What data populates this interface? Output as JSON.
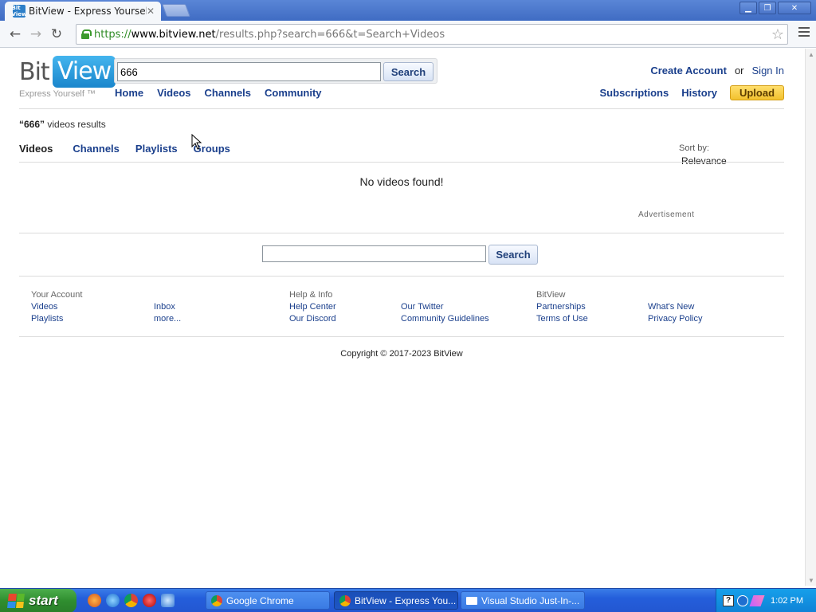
{
  "browser": {
    "tab_title": "BitView - Express Yourself.",
    "favicon_text": "Bit View",
    "url_scheme": "https://",
    "url_host": "www.bitview.net",
    "url_path": "/results.php?search=666&t=Search+Videos"
  },
  "site": {
    "logo_bit": "Bit",
    "logo_view": "View",
    "tagline": "Express Yourself ™",
    "search_value": "666",
    "search_button": "Search",
    "nav": [
      "Home",
      "Videos",
      "Channels",
      "Community"
    ],
    "create_account": "Create Account",
    "or": "or",
    "sign_in": "Sign In",
    "subscriptions": "Subscriptions",
    "history": "History",
    "upload": "Upload"
  },
  "results": {
    "query": "“666”",
    "suffix": "videos results",
    "tabs": [
      "Videos",
      "Channels",
      "Playlists",
      "Groups"
    ],
    "sort_label": "Sort by:",
    "sort_value": "Relevance",
    "empty_message": "No videos found!",
    "advertisement": "Advertisement"
  },
  "bottom_search": {
    "value": "",
    "button": "Search"
  },
  "footer": {
    "your_account": {
      "heading": "Your Account",
      "col1": [
        "Videos",
        "Playlists"
      ],
      "col2": [
        "Inbox",
        "more..."
      ]
    },
    "help": {
      "heading": "Help & Info",
      "col1": [
        "Help Center",
        "Our Discord"
      ],
      "col2": [
        "Our Twitter",
        "Community Guidelines"
      ]
    },
    "bitview": {
      "heading": "BitView",
      "col1": [
        "Partnerships",
        "Terms of Use"
      ],
      "col2": [
        "What's New",
        "Privacy Policy"
      ]
    },
    "copyright": "Copyright © 2017-2023 BitView"
  },
  "taskbar": {
    "start": "start",
    "tasks": [
      "Google Chrome",
      "BitView - Express You...",
      "Visual Studio Just-In-..."
    ],
    "clock": "1:02 PM"
  }
}
